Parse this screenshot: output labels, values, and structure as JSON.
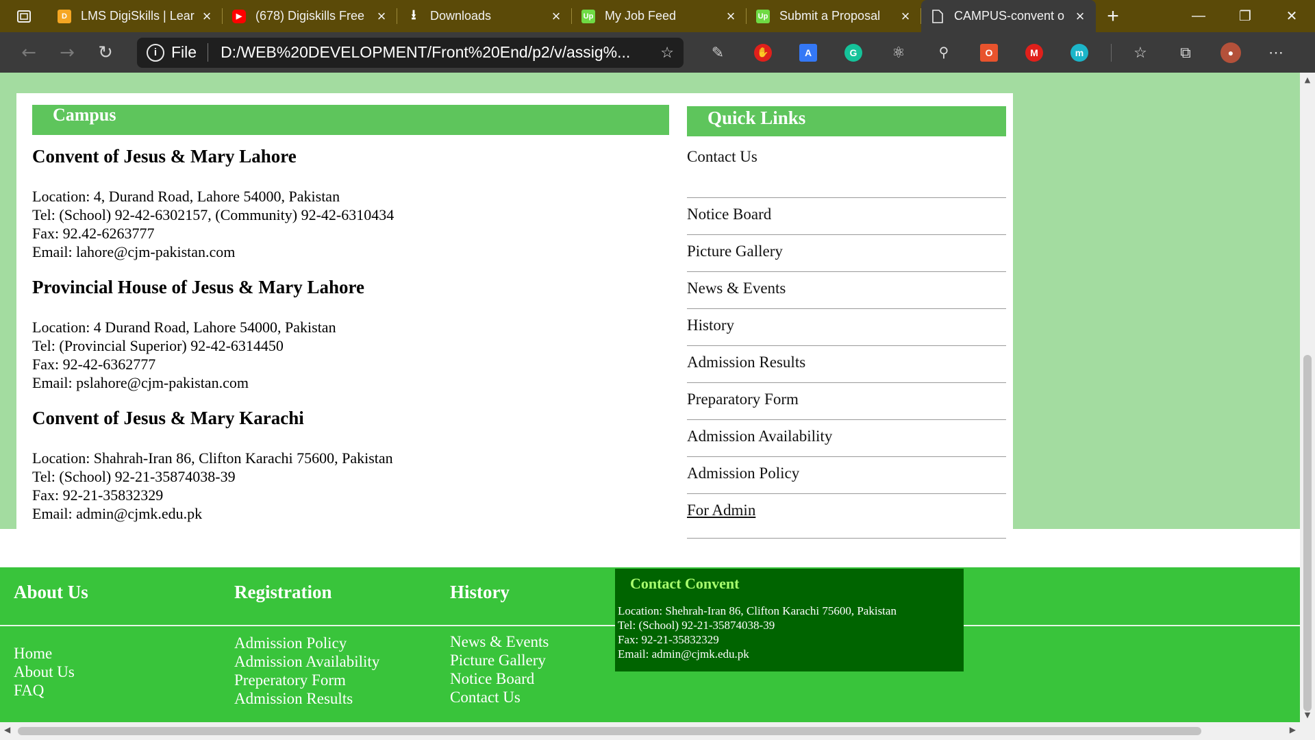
{
  "browser": {
    "tabs": [
      {
        "title": "LMS DigiSkills | Lear",
        "icon": "digiskills-icon",
        "color": "#f5a623",
        "active": false
      },
      {
        "title": "(678) Digiskills Free",
        "icon": "youtube-icon",
        "color": "#ff0000",
        "active": false
      },
      {
        "title": "Downloads",
        "icon": "download-icon",
        "color": "#ffffff",
        "active": false
      },
      {
        "title": "My Job Feed",
        "icon": "upwork-icon",
        "color": "#6fda44",
        "active": false
      },
      {
        "title": "Submit a Proposal",
        "icon": "upwork-icon",
        "color": "#6fda44",
        "active": false
      },
      {
        "title": "CAMPUS-convent o",
        "icon": "page-icon",
        "color": "#ffffff",
        "active": true
      }
    ],
    "address": {
      "scheme": "File",
      "url": "D:/WEB%20DEVELOPMENT/Front%20End/p2/v/assig%..."
    },
    "colors": {
      "tabbar": "#5b4a08",
      "toolbar": "#3b3b3b"
    }
  },
  "page": {
    "campus": {
      "heading": "Campus",
      "blocks": [
        {
          "name": "Convent of Jesus & Mary Lahore",
          "lines": [
            "Location: 4, Durand Road, Lahore 54000, Pakistan",
            "Tel: (School) 92-42-6302157, (Community) 92-42-6310434",
            "Fax: 92.42-6263777",
            "Email: lahore@cjm-pakistan.com"
          ]
        },
        {
          "name": "Provincial House of Jesus & Mary Lahore",
          "lines": [
            "Location: 4 Durand Road, Lahore 54000, Pakistan",
            "Tel: (Provincial Superior) 92-42-6314450",
            "Fax: 92-42-6362777",
            "Email: pslahore@cjm-pakistan.com"
          ]
        },
        {
          "name": "Convent of Jesus & Mary Karachi",
          "lines": [
            "Location: Shahrah-Iran 86, Clifton Karachi 75600, Pakistan",
            "Tel: (School) 92-21-35874038-39",
            "Fax: 92-21-35832329",
            "Email: admin@cjmk.edu.pk"
          ]
        }
      ]
    },
    "quick_links": {
      "heading": "Quick Links",
      "items": [
        "Contact Us",
        "Notice Board",
        "Picture Gallery",
        "News & Events",
        "History",
        "Admission Results",
        "Preparatory Form",
        "Admission Availability",
        "Admission Policy",
        "For Admin"
      ]
    },
    "footer": {
      "about": {
        "heading": "About Us",
        "links": [
          "Home",
          "About Us",
          "FAQ"
        ]
      },
      "registration": {
        "heading": "Registration",
        "links": [
          "Admission Policy",
          "Admission Availability",
          "Preperatory Form",
          "Admission Results"
        ]
      },
      "history": {
        "heading": "History",
        "links": [
          "News & Events",
          "Picture Gallery",
          "Notice Board",
          "Contact Us"
        ]
      },
      "contact": {
        "heading": "Contact Convent",
        "lines": [
          "Location: Shehrah-Iran 86, Clifton Karachi 75600, Pakistan",
          "Tel: (School) 92-21-35874038-39",
          "Fax: 92-21-35832329",
          "Email: admin@cjmk.edu.pk"
        ]
      }
    },
    "colors": {
      "page_bg": "#a3dca0",
      "section_header": "#5ec55c",
      "footer_bg": "#39c43b",
      "contact_box": "#006400",
      "contact_title": "#a9ff6e"
    }
  }
}
